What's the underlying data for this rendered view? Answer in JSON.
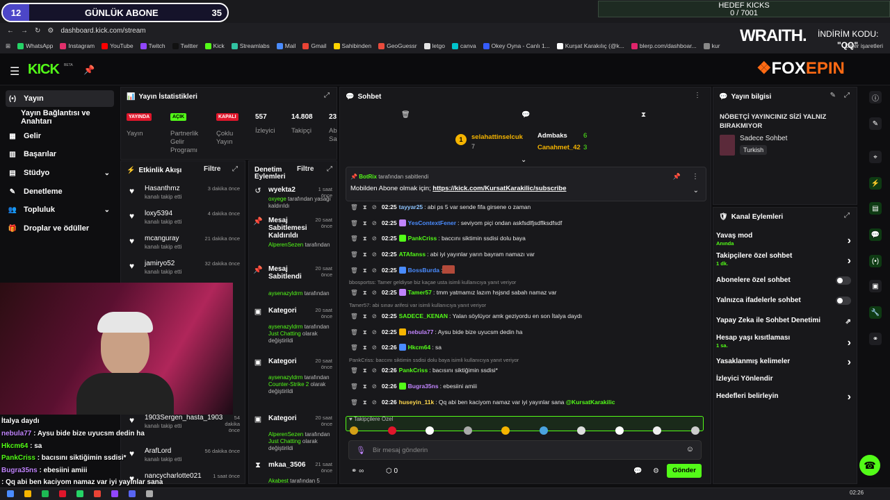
{
  "overlay": {
    "goal_count": "12",
    "goal_title": "GÜNLÜK ABONE",
    "goal_target": "35",
    "kick_goal_title": "HEDEF KICKS",
    "kick_goal_value": "0 / 7001",
    "wraith_brand": "WRAITH.",
    "wraith_discount": "İNDİRİM KODU:",
    "wraith_code": "\"QQ\"",
    "foxepin_brand_a": "FOX",
    "foxepin_brand_b": "EPIN",
    "chat_overlay": [
      {
        "user": "",
        "text": "İtalya daydı"
      },
      {
        "user": "nebula77",
        "text": " : Aysu bide bize uyucsm dedin ha"
      },
      {
        "user": "Hkcm64",
        "text": " : sa"
      },
      {
        "user": "PankCriss",
        "text": " : bacısını siktiğimin ssdisi*"
      },
      {
        "user": "Bugra35ns",
        "text": " : ebesiini amiii"
      },
      {
        "user": "",
        "text": ": Qq abi ben kaciyom namaz var iyi yayınlar sana"
      }
    ]
  },
  "browser": {
    "url": "dashboard.kick.com/stream",
    "bookmarks": [
      "WhatsApp",
      "Instagram",
      "YouTube",
      "Twitch",
      "Twitter",
      "Kick",
      "Streamlabs",
      "Mail",
      "Gmail",
      "Sahibinden",
      "GeoGuessr",
      "letgo",
      "canva",
      "Okey Oyna - Canlı 1...",
      "Kurşat Karakılıç (@k...",
      "blerp.com/dashboar...",
      "kur"
    ],
    "bookmarks_right": "Diğer işaretleri"
  },
  "header": {
    "logo": "KICK",
    "beta": "BETA"
  },
  "nav": {
    "items": [
      {
        "icon": "(•)",
        "label": "Yayın"
      },
      {
        "icon": "",
        "label": "Yayın Bağlantısı ve Anahtarı"
      },
      {
        "icon": "▦",
        "label": "Gelir"
      },
      {
        "icon": "▥",
        "label": "Başarılar"
      },
      {
        "icon": "▤",
        "label": "Stüdyo"
      },
      {
        "icon": "✎",
        "label": "Denetleme"
      },
      {
        "icon": "👥",
        "label": "Topluluk"
      },
      {
        "icon": "🎁",
        "label": "Droplar ve ödüller"
      }
    ]
  },
  "stats": {
    "title": "Yayın İstatistikleri",
    "live_badge": "YAYINDA",
    "live_label": "Yayın",
    "partner_badge": "AÇIK",
    "partner_label": "Partnerlik Gelir Programı",
    "multi_badge": "KAPALI",
    "multi_label": "Çoklu Yayın",
    "viewers": "557",
    "viewers_label": "İzleyici",
    "followers": "14.808",
    "followers_label": "Takipçi",
    "third": "23",
    "third_label": "Ab Sa"
  },
  "activity": {
    "title": "Etkinlik Akışı",
    "filter": "Filtre",
    "items": [
      {
        "name": "Hasanthmz",
        "sub": "kanalı takip etti",
        "time": "3 dakika önce"
      },
      {
        "name": "loxy5394",
        "sub": "kanalı takip etti",
        "time": "4 dakika önce"
      },
      {
        "name": "mcanguray",
        "sub": "kanalı takip etti",
        "time": "21 dakika önce"
      },
      {
        "name": "jamiryo52",
        "sub": "kanalı takip etti",
        "time": "32 dakika önce"
      },
      {
        "name": "1903Sergen_hasta_1903",
        "sub": "kanalı takip etti",
        "time": "54 dakika önce"
      },
      {
        "name": "ArafLord",
        "sub": "kanalı takip etti",
        "time": "56 dakika önce"
      },
      {
        "name": "nancycharlotte021",
        "sub": "",
        "time": "1 saat önce"
      }
    ]
  },
  "moderation": {
    "title": "Denetim Eylemleri",
    "filter": "Filtre",
    "items": [
      {
        "icon": "↺",
        "title": "wyekta2",
        "time": "1 saat önce",
        "user": "oxyege",
        "desc": " tarafından yasağı kaldırıldı",
        "extra": ""
      },
      {
        "icon": "📌",
        "title": "Mesaj Sabitlemesi Kaldırıldı",
        "time": "20 saat önce",
        "user": "AlperenSezen",
        "desc": " tarafından",
        "extra": ""
      },
      {
        "icon": "📌",
        "title": "Mesaj Sabitlendi",
        "time": "20 saat önce",
        "user": "aysenazyldrm",
        "desc": " tarafından",
        "extra": ""
      },
      {
        "icon": "▣",
        "title": "Kategori",
        "time": "20 saat önce",
        "user": "aysenazyldrm",
        "desc": " tarafından ",
        "extra": "Just Chatting",
        "tail": " olarak değiştirildi"
      },
      {
        "icon": "▣",
        "title": "Kategori",
        "time": "20 saat önce",
        "user": "aysenazyldrm",
        "desc": " tarafından ",
        "extra": "Counter-Strike 2",
        "tail": " olarak değiştirildi"
      },
      {
        "icon": "▣",
        "title": "Kategori",
        "time": "20 saat önce",
        "user": "AlperenSezen",
        "desc": " tarafından ",
        "extra": "Just Chatting",
        "tail": " olarak değiştirildi"
      },
      {
        "icon": "⧗",
        "title": "mkaa_3506",
        "time": "21 saat önce",
        "user": "Akabest",
        "desc": " tarafından 5",
        "extra": ""
      }
    ]
  },
  "chat": {
    "title": "Sohbet",
    "top_user": "selahattinselcuk",
    "top_user_score": "7",
    "leader_1": "Admbaks",
    "leader_1_score": "6",
    "leader_2": "Canahmet_42",
    "leader_2_score": "3",
    "pinned_by": "BotRix",
    "pinned_by_suffix": " tarafından sabitlendi",
    "pinned_text": "Mobilden Abone olmak için; ",
    "pinned_link": "https://kick.com/KursatKarakilic/subscribe",
    "messages": [
      {
        "time": "02:25",
        "user": "tayyar25",
        "color": "#8ec5ff",
        "text": ": abi ps 5 var sende fifa girsene o zaman",
        "reply": ""
      },
      {
        "time": "02:25",
        "user": "YesContextFener",
        "color": "#4a8cff",
        "text": ": seviyom piçi ondan askfsdlfjsdflksdfsdf",
        "reply": ""
      },
      {
        "time": "02:25",
        "user": "PankCriss",
        "color": "#53fc18",
        "text": ": baccını siktimin ssdisi dolu baya",
        "reply": ""
      },
      {
        "time": "02:25",
        "user": "ATAfanss",
        "color": "#53fc18",
        "text": ": abi iyi yayınlar yarın bayram namazı var",
        "reply": ""
      },
      {
        "time": "02:25",
        "user": "BossBurda",
        "color": "#4a8cff",
        "text": ":",
        "reply": ""
      },
      {
        "time": "02:25",
        "user": "Tamer57",
        "color": "#53fc18",
        "text": ": tmm yatmamız lazım hsjsnd sabah namaz var",
        "reply": "bbosportss: Tamer geldiyse biz kaçae usta isimli kullanıcıya yanıt veriyor"
      },
      {
        "time": "02:25",
        "user": "SADECE_KENAN",
        "color": "#53fc18",
        "text": ": Yalan söylüyor amk geziyordu en son İtalya daydı",
        "reply": "Tamer57: abi sınav arifesi var isimli kullanıcıya yanıt veriyor"
      },
      {
        "time": "02:25",
        "user": "nebula77",
        "color": "#c084fc",
        "text": ": Aysu bide bize uyucsm dedin ha",
        "reply": ""
      },
      {
        "time": "02:26",
        "user": "Hkcm64",
        "color": "#53fc18",
        "text": ": sa",
        "reply": ""
      },
      {
        "time": "02:26",
        "user": "PankCriss",
        "color": "#53fc18",
        "text": ": bacısını siktiğimin ssdisi*",
        "reply": "PankCriss: baccını siktimin ssdisi dolu baya isimli kullanıcıya yanıt veriyor"
      },
      {
        "time": "02:26",
        "user": "Bugra35ns",
        "color": "#c084fc",
        "text": ": ebesiini amiii",
        "reply": ""
      },
      {
        "time": "02:26",
        "user": "huseyin_11k",
        "color": "#ffd84d",
        "text": ": Qq abi ben kaciyom namaz var iyi yayınlar sana ",
        "mention": "@KursatKarakilic",
        "reply": ""
      }
    ],
    "followers_only": "Takipçilere Özel",
    "input_placeholder": "Bir mesaj gönderin",
    "points": "0",
    "send": "Gönder"
  },
  "stream_info": {
    "title": "Yayın bilgisi",
    "headline": "NÖBETÇİ YAYINCINIZ SİZİ YALNIZ BIRAKMIYOR",
    "category": "Sadece Sohbet",
    "language": "Turkish"
  },
  "channel_actions": {
    "title": "Kanal Eylemleri",
    "items": [
      {
        "label": "Yavaş mod",
        "sub": "Anında",
        "kind": "chevron"
      },
      {
        "label": "Takipçilere özel sohbet",
        "sub": "1 dk.",
        "kind": "chevron"
      },
      {
        "label": "Abonelere özel sohbet",
        "sub": "",
        "kind": "toggle"
      },
      {
        "label": "Yalnızca ifadelerle sohbet",
        "sub": "",
        "kind": "toggle"
      },
      {
        "label": "Yapay Zeka ile Sohbet Denetimi",
        "sub": "",
        "kind": "external"
      },
      {
        "label": "Hesap yaşı kısıtlaması",
        "sub": "1 sa.",
        "kind": "chevron"
      },
      {
        "label": "Yasaklanmış kelimeler",
        "sub": "",
        "kind": "chevron"
      },
      {
        "label": "İzleyici Yönlendir",
        "sub": "",
        "kind": "none"
      },
      {
        "label": "Hedefleri belirleyin",
        "sub": "",
        "kind": "chevron"
      }
    ]
  },
  "taskbar": {
    "time": "02:26"
  },
  "colors": {
    "kick_green": "#53fc18",
    "panel": "#18181b",
    "bg": "#0e0e10"
  }
}
